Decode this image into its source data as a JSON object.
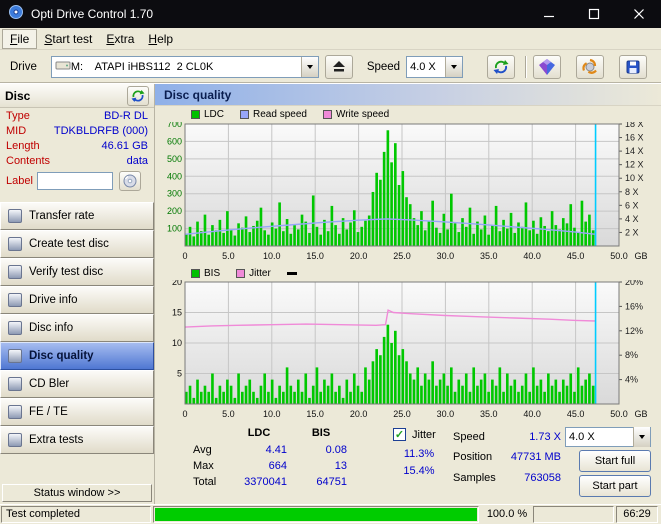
{
  "window": {
    "title": "Opti Drive Control 1.70"
  },
  "menu": {
    "items": [
      "File",
      "Start test",
      "Extra",
      "Help"
    ]
  },
  "toolbar": {
    "drive_label": "Drive",
    "drive_value": "M:    ATAPI iHBS112  2 CL0K",
    "speed_label": "Speed",
    "speed_value": "4.0 X"
  },
  "icons": {
    "check": "✓"
  },
  "sidebar": {
    "header": "Disc",
    "info": [
      {
        "label": "Type",
        "value": "BD-R DL"
      },
      {
        "label": "MID",
        "value": "TDKBLDRFB (000)"
      },
      {
        "label": "Length",
        "value": "46.61 GB"
      },
      {
        "label": "Contents",
        "value": "data"
      }
    ],
    "label_field": {
      "label": "Label",
      "value": ""
    },
    "buttons": [
      {
        "label": "Transfer rate",
        "slug": "transfer-rate"
      },
      {
        "label": "Create test disc",
        "slug": "create-test-disc"
      },
      {
        "label": "Verify test disc",
        "slug": "verify-test-disc"
      },
      {
        "label": "Drive info",
        "slug": "drive-info"
      },
      {
        "label": "Disc info",
        "slug": "disc-info"
      },
      {
        "label": "Disc quality",
        "slug": "disc-quality",
        "active": true
      },
      {
        "label": "CD Bler",
        "slug": "cd-bler"
      },
      {
        "label": "FE / TE",
        "slug": "fe-te"
      },
      {
        "label": "Extra tests",
        "slug": "extra-tests"
      }
    ],
    "status_window_button": "Status window >>"
  },
  "panel": {
    "title": "Disc quality"
  },
  "legend_top": [
    {
      "label": "LDC",
      "color": "#00c000"
    },
    {
      "label": "Read speed",
      "color": "#98a6f8"
    },
    {
      "label": "Write speed",
      "color": "#f08ad8"
    }
  ],
  "legend_bottom": [
    {
      "label": "BIS",
      "color": "#00c000"
    },
    {
      "label": "Jitter",
      "color": "#f08ad8"
    },
    {
      "label": "",
      "color": "#000000",
      "marker": true
    }
  ],
  "results": {
    "col_headers": [
      "LDC",
      "BIS"
    ],
    "rows": [
      {
        "label": "Avg",
        "ldc": "4.41",
        "bis": "0.08"
      },
      {
        "label": "Max",
        "ldc": "664",
        "bis": "13"
      },
      {
        "label": "Total",
        "ldc": "3370041",
        "bis": "64751"
      }
    ],
    "jitter_label": "Jitter",
    "jitter_checked": true,
    "jitter_values": [
      "11.3%",
      "15.4%"
    ],
    "stats": [
      {
        "label": "Speed",
        "value": "1.73 X"
      },
      {
        "label": "Position",
        "value": "47731 MB"
      },
      {
        "label": "Samples",
        "value": "763058"
      }
    ],
    "speed_select": "4.0 X",
    "start_full_label": "Start full",
    "start_part_label": "Start part"
  },
  "statusbar": {
    "status": "Test completed",
    "progress_pct": 100,
    "progress_label": "100.0 %",
    "time": "66:29"
  },
  "chart_data": [
    {
      "type": "bar",
      "name": "ldc-read-speed",
      "y_left": {
        "max": 700,
        "ticks": [
          100,
          200,
          300,
          400,
          500,
          600,
          700
        ],
        "color": "#007800"
      },
      "y_right": {
        "max": 18,
        "ticks": [
          {
            "v": 18,
            "label": "18 X"
          },
          {
            "v": 16,
            "label": "16 X"
          },
          {
            "v": 14,
            "label": "14 X"
          },
          {
            "v": 12,
            "label": "12 X"
          },
          {
            "v": 10,
            "label": "10 X"
          },
          {
            "v": 8,
            "label": "8 X"
          },
          {
            "v": 6,
            "label": "6 X"
          },
          {
            "v": 4,
            "label": "4 X"
          },
          {
            "v": 2,
            "label": "2 X"
          }
        ]
      },
      "x": {
        "max": 50,
        "unit": "GB",
        "ticks": [
          "0",
          "5.0",
          "10.0",
          "15.0",
          "20.0",
          "25.0",
          "30.0",
          "35.0",
          "40.0",
          "45.0",
          "50.0"
        ]
      },
      "bars": {
        "name": "LDC",
        "color": "#00c800",
        "span_max": 47.3,
        "values": [
          70,
          110,
          55,
          140,
          85,
          180,
          65,
          120,
          90,
          150,
          75,
          200,
          95,
          60,
          130,
          105,
          170,
          80,
          115,
          145,
          220,
          90,
          65,
          135,
          100,
          250,
          85,
          155,
          70,
          120,
          95,
          180,
          140,
          75,
          290,
          110,
          65,
          150,
          85,
          230,
          120,
          70,
          160,
          95,
          135,
          205,
          80,
          110,
          145,
          175,
          310,
          420,
          380,
          540,
          664,
          480,
          590,
          350,
          430,
          280,
          240,
          160,
          120,
          200,
          90,
          140,
          260,
          105,
          75,
          185,
          95,
          300,
          130,
          80,
          160,
          110,
          220,
          70,
          140,
          95,
          175,
          65,
          120,
          230,
          85,
          150,
          100,
          190,
          75,
          135,
          110,
          250,
          90,
          145,
          70,
          165,
          115,
          85,
          200,
          120,
          95,
          160,
          130,
          240,
          105,
          75,
          260,
          140,
          180,
          90
        ]
      },
      "lines": [
        {
          "name": "Read speed",
          "color": "#98a6f8",
          "axis": "right",
          "points": [
            [
              0,
              1.73
            ],
            [
              4,
              2.25
            ],
            [
              8,
              2.7
            ],
            [
              12,
              3.1
            ],
            [
              16,
              3.5
            ],
            [
              20,
              3.8
            ],
            [
              23.3,
              4.0
            ],
            [
              26,
              3.85
            ],
            [
              30,
              3.55
            ],
            [
              34,
              3.2
            ],
            [
              38,
              2.8
            ],
            [
              42,
              2.4
            ],
            [
              45,
              2.05
            ],
            [
              47.3,
              1.73
            ]
          ]
        }
      ],
      "marker": {
        "x": 47.3,
        "color": "#00ccff"
      }
    },
    {
      "type": "bar",
      "name": "bis-jitter",
      "y_left": {
        "max": 20,
        "ticks": [
          5,
          10,
          15,
          20
        ],
        "color": "#111111"
      },
      "y_right": {
        "max": 20,
        "ticks": [
          {
            "v": 20,
            "label": "20%"
          },
          {
            "v": 16,
            "label": "16%"
          },
          {
            "v": 12,
            "label": "12%"
          },
          {
            "v": 8,
            "label": "8%"
          },
          {
            "v": 4,
            "label": "4%"
          }
        ]
      },
      "x": {
        "max": 50,
        "unit": "GB",
        "ticks": [
          "0",
          "5.0",
          "10.0",
          "15.0",
          "20.0",
          "25.0",
          "30.0",
          "35.0",
          "40.0",
          "45.0",
          "50.0"
        ]
      },
      "bars": {
        "name": "BIS",
        "color": "#00c800",
        "span_max": 47.3,
        "values": [
          2,
          3,
          1,
          4,
          2,
          3,
          2,
          5,
          1,
          3,
          2,
          4,
          3,
          1,
          5,
          2,
          3,
          4,
          2,
          1,
          3,
          5,
          2,
          4,
          1,
          3,
          2,
          6,
          3,
          2,
          4,
          2,
          5,
          1,
          3,
          6,
          2,
          4,
          3,
          5,
          2,
          3,
          1,
          4,
          2,
          5,
          3,
          2,
          6,
          4,
          7,
          9,
          8,
          11,
          13,
          10,
          12,
          8,
          9,
          7,
          5,
          4,
          6,
          3,
          5,
          4,
          7,
          3,
          4,
          5,
          3,
          6,
          2,
          4,
          3,
          5,
          2,
          6,
          3,
          4,
          5,
          2,
          4,
          3,
          6,
          2,
          5,
          3,
          4,
          2,
          3,
          5,
          2,
          6,
          3,
          4,
          2,
          5,
          3,
          4,
          2,
          4,
          3,
          5,
          2,
          6,
          3,
          4,
          5,
          3
        ]
      },
      "lines": [
        {
          "name": "Jitter",
          "color": "#f08ad8",
          "axis": "right",
          "points": [
            [
              0,
              12.6
            ],
            [
              3,
              12.8
            ],
            [
              6,
              12.9
            ],
            [
              10,
              13.0
            ],
            [
              14,
              13.1
            ],
            [
              18,
              13.0
            ],
            [
              22,
              12.9
            ],
            [
              23.1,
              13.0
            ],
            [
              23.4,
              15.4
            ],
            [
              24,
              15.0
            ],
            [
              26,
              14.8
            ],
            [
              30,
              14.5
            ],
            [
              34,
              14.3
            ],
            [
              38,
              14.1
            ],
            [
              42,
              13.9
            ],
            [
              45,
              13.7
            ],
            [
              47.3,
              13.6
            ]
          ]
        }
      ],
      "marker": {
        "x": 47.3,
        "color": "#00ccff"
      }
    }
  ]
}
